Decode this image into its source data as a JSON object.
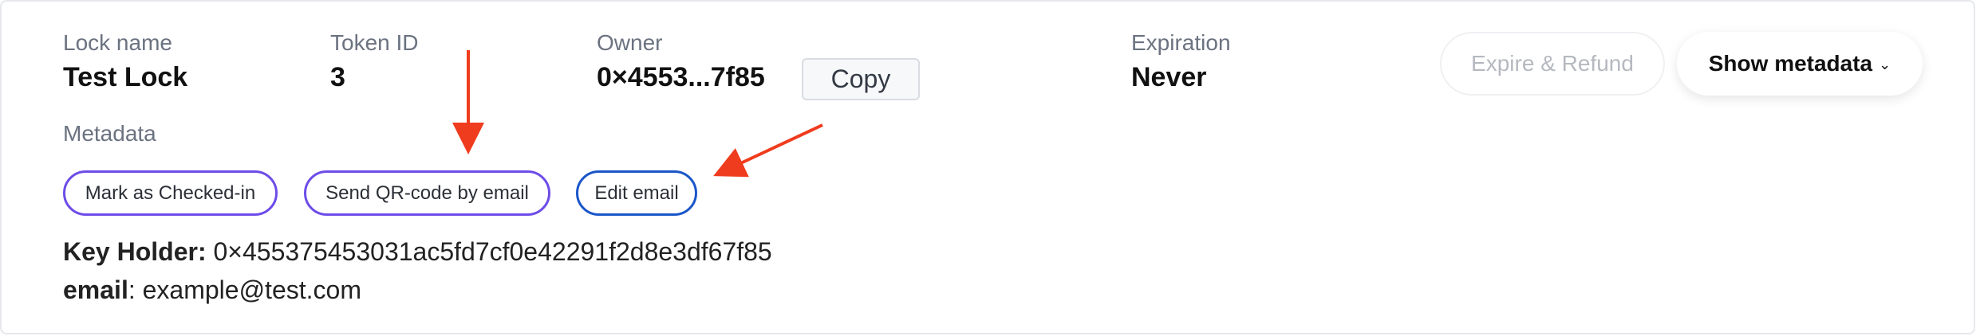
{
  "fields": {
    "lock_name_label": "Lock name",
    "lock_name_value": "Test Lock",
    "token_id_label": "Token ID",
    "token_id_value": "3",
    "owner_label": "Owner",
    "owner_value": "0×4553...7f85",
    "copy_label": "Copy",
    "expiration_label": "Expiration",
    "expiration_value": "Never"
  },
  "actions": {
    "expire_refund_label": "Expire & Refund",
    "expire_refund_enabled": false,
    "show_metadata_label": "Show metadata",
    "show_metadata_icon": "chevron-down-icon"
  },
  "metadata": {
    "heading": "Metadata",
    "buttons": {
      "mark_checked_in": "Mark as Checked-in",
      "send_qr": "Send QR-code by email",
      "edit_email": "Edit email"
    },
    "key_holder_label": "Key Holder:",
    "key_holder_value": "0×455375453031ac5fd7cf0e42291f2d8e3df67f85",
    "email_label": "email",
    "email_separator": ":",
    "email_value": "example@test.com"
  },
  "annotations": {
    "arrow_color": "#f03c1e",
    "button_purple": "#6d4ce8",
    "button_blue": "#1a56c9"
  }
}
